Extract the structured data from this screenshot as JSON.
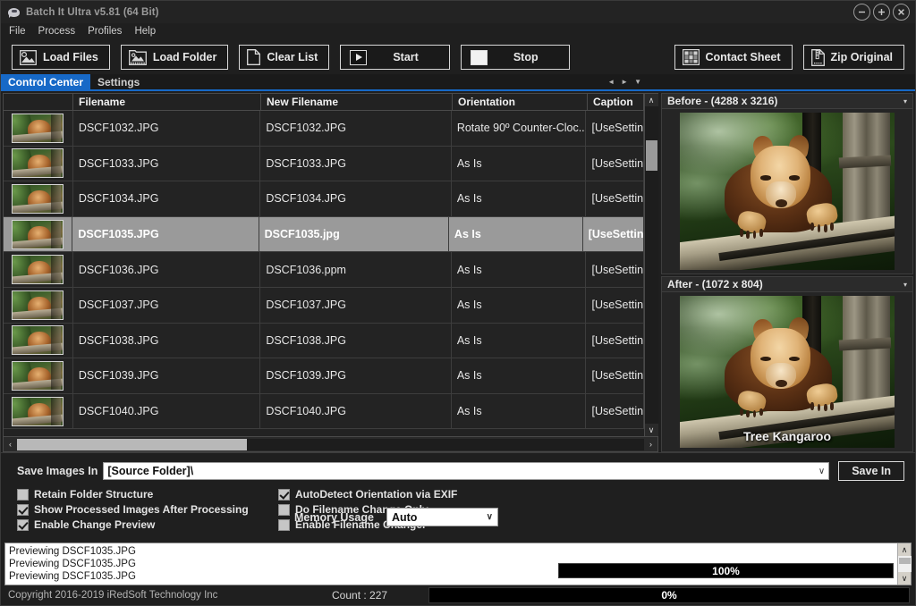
{
  "window": {
    "title": "Batch It Ultra v5.81 (64 Bit)",
    "icon": "app-icon",
    "minimize": "−",
    "maximize": "+",
    "close": "×"
  },
  "menu": {
    "items": [
      {
        "label": "File"
      },
      {
        "label": "Process"
      },
      {
        "label": "Profiles"
      },
      {
        "label": "Help"
      }
    ]
  },
  "toolbar": {
    "load_files": "Load Files",
    "load_folder": "Load Folder",
    "clear_list": "Clear List",
    "start": "Start",
    "stop": "Stop",
    "contact_sheet": "Contact Sheet",
    "zip_original": "Zip Original"
  },
  "tabs": {
    "items": [
      {
        "label": "Control Center",
        "active": true
      },
      {
        "label": "Settings",
        "active": false
      }
    ],
    "nav_prev": "◄",
    "nav_next": "►",
    "nav_menu": "▼"
  },
  "table": {
    "columns": [
      "",
      "Filename",
      "New Filename",
      "Orientation",
      "Caption"
    ],
    "rows": [
      {
        "filename": "DSCF1032.JPG",
        "new_filename": "DSCF1032.JPG",
        "orientation": "Rotate 90º Counter-Cloc...",
        "caption": "[UseSettin",
        "selected": false
      },
      {
        "filename": "DSCF1033.JPG",
        "new_filename": "DSCF1033.JPG",
        "orientation": "As Is",
        "caption": "[UseSettin",
        "selected": false
      },
      {
        "filename": "DSCF1034.JPG",
        "new_filename": "DSCF1034.JPG",
        "orientation": "As Is",
        "caption": "[UseSettin",
        "selected": false
      },
      {
        "filename": "DSCF1035.JPG",
        "new_filename": "DSCF1035.jpg",
        "orientation": "As Is",
        "caption": "[UseSettin",
        "selected": true
      },
      {
        "filename": "DSCF1036.JPG",
        "new_filename": "DSCF1036.ppm",
        "orientation": "As Is",
        "caption": "[UseSettin",
        "selected": false
      },
      {
        "filename": "DSCF1037.JPG",
        "new_filename": "DSCF1037.JPG",
        "orientation": "As Is",
        "caption": "[UseSettin",
        "selected": false
      },
      {
        "filename": "DSCF1038.JPG",
        "new_filename": "DSCF1038.JPG",
        "orientation": "As Is",
        "caption": "[UseSettin",
        "selected": false
      },
      {
        "filename": "DSCF1039.JPG",
        "new_filename": "DSCF1039.JPG",
        "orientation": "As Is",
        "caption": "[UseSettin",
        "selected": false
      },
      {
        "filename": "DSCF1040.JPG",
        "new_filename": "DSCF1040.JPG",
        "orientation": "As Is",
        "caption": "[UseSettin",
        "selected": false
      }
    ],
    "scroll_up": "∧",
    "scroll_down": "∨",
    "scroll_left": "‹",
    "scroll_right": "›"
  },
  "preview": {
    "before": {
      "title": "Before - (4288 x 3216)",
      "caret": "▾",
      "photo_caption": ""
    },
    "after": {
      "title": "After - (1072 x 804)",
      "caret": "▾",
      "photo_caption": "Tree Kangaroo"
    }
  },
  "settings": {
    "save_images_in_label": "Save Images In",
    "save_path_value": "[Source Folder]\\",
    "save_in_button": "Save In",
    "dropdown_caret": "∨",
    "options_left": [
      {
        "label": "Retain Folder Structure",
        "checked": false
      },
      {
        "label": "Show Processed Images After Processing",
        "checked": true
      },
      {
        "label": "Enable Change Preview",
        "checked": true
      }
    ],
    "options_right": [
      {
        "label": "AutoDetect Orientation via EXIF",
        "checked": true
      },
      {
        "label": "Do Filename Change Only",
        "checked": false
      },
      {
        "label": "Enable Filename Changer",
        "checked": false
      }
    ],
    "memory_usage_label": "Memory Usage",
    "memory_usage_value": "Auto",
    "memory_bar_pct": "100%"
  },
  "log": {
    "lines": [
      "Previewing DSCF1035.JPG",
      "Previewing DSCF1035.JPG",
      "Previewing DSCF1035.JPG"
    ],
    "scroll_up": "∧",
    "scroll_down": "∨"
  },
  "statusbar": {
    "copyright": "Copyright 2016-2019 iRedSoft Technology Inc",
    "count": "Count : 227",
    "progress_pct": "0%"
  },
  "colors": {
    "accent": "#1769c7",
    "window_bg": "#1f1f1f",
    "selected_row": "#9a9a9a"
  }
}
